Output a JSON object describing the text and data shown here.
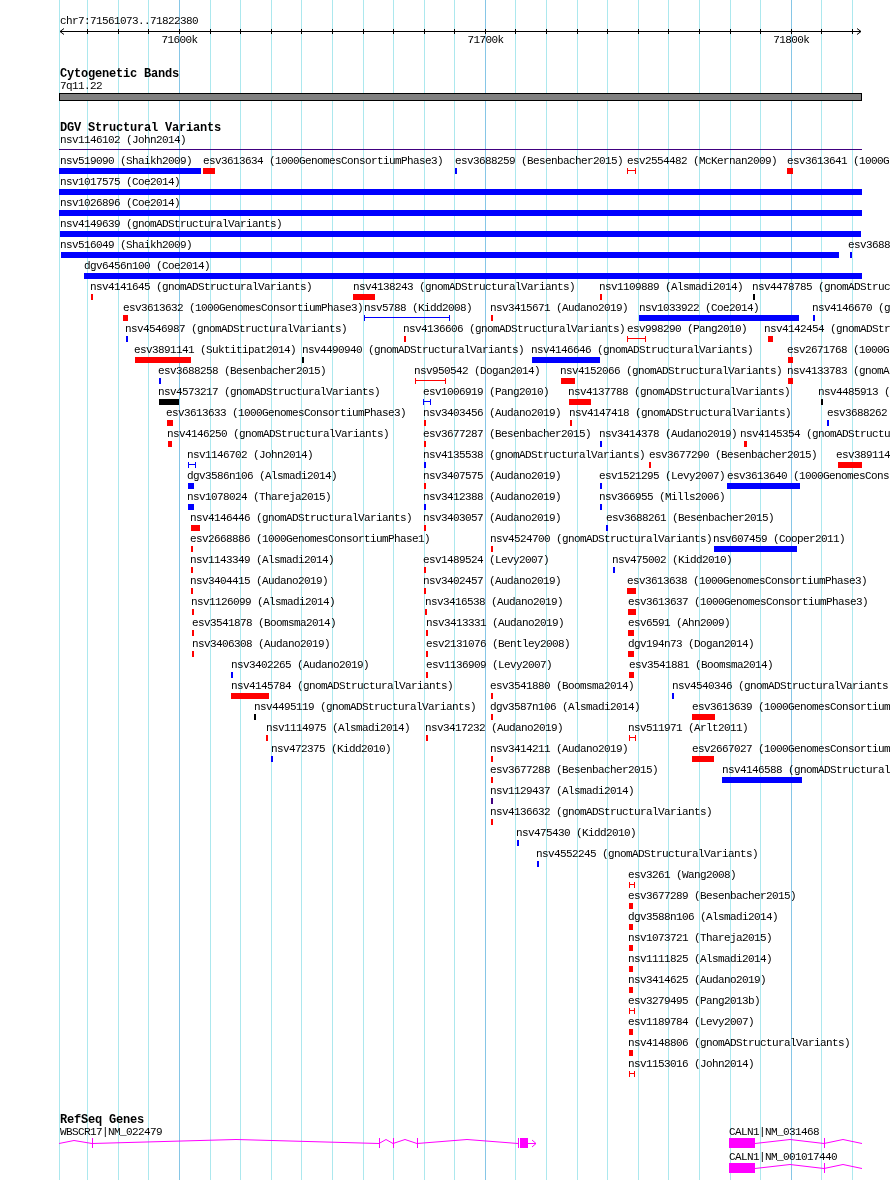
{
  "ruler": {
    "region": "chr7:71561073..71822380",
    "ticks": [
      "71600k",
      "71700k",
      "71800k"
    ]
  },
  "cytogenetic_bands": {
    "title": "Cytogenetic Bands",
    "band": "7q11.22"
  },
  "dgv_structural_variants": {
    "title": "DGV Structural Variants",
    "rows": [
      {
        "features": [
          {
            "label": "nsv1146102 (John2014)",
            "kind": "line",
            "color": "#400080"
          }
        ]
      },
      {
        "features": [
          {
            "label": "nsv519090 (Shaikh2009)",
            "kind": "block",
            "color": "#0000ff"
          },
          {
            "label": "esv3613634 (1000GenomesConsortiumPhase3)",
            "kind": "block",
            "color": "#ff0000"
          },
          {
            "label": "esv3688259 (Besenbacher2015)",
            "kind": "block",
            "color": "#0000ff"
          },
          {
            "label": "esv2554482 (McKernan2009)",
            "kind": "span",
            "color": "#ff0000"
          },
          {
            "label": "esv3613641 (1000G",
            "kind": "block",
            "color": "#ff0000"
          }
        ]
      },
      {
        "features": [
          {
            "label": "nsv1017575 (Coe2014)",
            "kind": "block",
            "color": "#0000ff"
          }
        ]
      },
      {
        "features": [
          {
            "label": "nsv1026896 (Coe2014)",
            "kind": "block",
            "color": "#0000ff"
          }
        ]
      },
      {
        "features": [
          {
            "label": "nsv4149639 (gnomADStructuralVariants)",
            "kind": "block",
            "color": "#0000ff"
          }
        ]
      },
      {
        "features": [
          {
            "label": "nsv516049 (Shaikh2009)",
            "kind": "block",
            "color": "#0000ff"
          },
          {
            "label": "esv3688",
            "kind": "block",
            "color": "#0000ff"
          }
        ]
      },
      {
        "features": [
          {
            "label": "dgv6456n100 (Coe2014)",
            "kind": "block",
            "color": "#0000ff"
          }
        ]
      },
      {
        "features": [
          {
            "label": "nsv4141645 (gnomADStructuralVariants)",
            "kind": "block",
            "color": "#ff0000"
          },
          {
            "label": "nsv4138243 (gnomADStructuralVariants)",
            "kind": "block",
            "color": "#ff0000"
          },
          {
            "label": "nsv1109889 (Alsmadi2014)",
            "kind": "block",
            "color": "#ff0000"
          },
          {
            "label": "nsv4478785 (gnomADStruc",
            "kind": "block",
            "color": "#000000"
          }
        ]
      },
      {
        "features": [
          {
            "label": "esv3613632 (1000GenomesConsortiumPhase3)",
            "kind": "block",
            "color": "#ff0000"
          },
          {
            "label": "nsv5788 (Kidd2008)",
            "kind": "span",
            "color": "#0000ff"
          },
          {
            "label": "nsv3415671 (Audano2019)",
            "kind": "block",
            "color": "#ff0000"
          },
          {
            "label": "nsv1033922 (Coe2014)",
            "kind": "block",
            "color": "#0000ff"
          },
          {
            "label": "nsv4146670 (g",
            "kind": "block",
            "color": "#0000ff"
          }
        ]
      },
      {
        "features": [
          {
            "label": "nsv4546987 (gnomADStructuralVariants)",
            "kind": "block",
            "color": "#0000ff"
          },
          {
            "label": "nsv4136606 (gnomADStructuralVariants)",
            "kind": "block",
            "color": "#ff0000"
          },
          {
            "label": "esv998290 (Pang2010)",
            "kind": "span",
            "color": "#ff0000"
          },
          {
            "label": "nsv4142454 (gnomADStr",
            "kind": "block",
            "color": "#ff0000"
          }
        ]
      },
      {
        "features": [
          {
            "label": "esv3891141 (Suktitipat2014)",
            "kind": "block",
            "color": "#ff0000"
          },
          {
            "label": "nsv4490940 (gnomADStructuralVariants)",
            "kind": "block",
            "color": "#000000"
          },
          {
            "label": "nsv4146646 (gnomADStructuralVariants)",
            "kind": "block",
            "color": "#0000ff"
          },
          {
            "label": "esv2671768 (1000G",
            "kind": "block",
            "color": "#ff0000"
          }
        ]
      },
      {
        "features": [
          {
            "label": "esv3688258 (Besenbacher2015)",
            "kind": "block",
            "color": "#0000ff"
          },
          {
            "label": "nsv950542 (Dogan2014)",
            "kind": "span",
            "color": "#ff0000"
          },
          {
            "label": "nsv4152066 (gnomADStructuralVariants)",
            "kind": "block",
            "color": "#ff0000"
          },
          {
            "label": "nsv4133783 (gnomA",
            "kind": "block",
            "color": "#ff0000"
          }
        ]
      },
      {
        "features": [
          {
            "label": "nsv4573217 (gnomADStructuralVariants)",
            "kind": "block",
            "color": "#000000"
          },
          {
            "label": "esv1006919 (Pang2010)",
            "kind": "span",
            "color": "#0000ff"
          },
          {
            "label": "nsv4137788 (gnomADStructuralVariants)",
            "kind": "block",
            "color": "#ff0000"
          },
          {
            "label": "nsv4485913 (",
            "kind": "block",
            "color": "#000000"
          }
        ]
      },
      {
        "features": [
          {
            "label": "esv3613633 (1000GenomesConsortiumPhase3)",
            "kind": "block",
            "color": "#ff0000"
          },
          {
            "label": "nsv3403456 (Audano2019)",
            "kind": "block",
            "color": "#ff0000"
          },
          {
            "label": "nsv4147418 (gnomADStructuralVariants)",
            "kind": "block",
            "color": "#ff0000"
          },
          {
            "label": "esv3688262",
            "kind": "block",
            "color": "#0000ff"
          }
        ]
      },
      {
        "features": [
          {
            "label": "nsv4146250 (gnomADStructuralVariants)",
            "kind": "block",
            "color": "#ff0000"
          },
          {
            "label": "esv3677287 (Besenbacher2015)",
            "kind": "block",
            "color": "#ff0000"
          },
          {
            "label": "nsv3414378 (Audano2019)",
            "kind": "block",
            "color": "#0000ff"
          },
          {
            "label": "nsv4145354 (gnomADStructu",
            "kind": "block",
            "color": "#ff0000"
          }
        ]
      },
      {
        "features": [
          {
            "label": "nsv1146702 (John2014)",
            "kind": "span",
            "color": "#0000ff"
          },
          {
            "label": "nsv4135538 (gnomADStructuralVariants)",
            "kind": "block",
            "color": "#0000ff"
          },
          {
            "label": "esv3677290 (Besenbacher2015)",
            "kind": "block",
            "color": "#ff0000"
          },
          {
            "label": "esv389114",
            "kind": "block",
            "color": "#ff0000"
          }
        ]
      },
      {
        "features": [
          {
            "label": "dgv3586n106 (Alsmadi2014)",
            "kind": "block",
            "color": "#0000ff"
          },
          {
            "label": "nsv3407575 (Audano2019)",
            "kind": "block",
            "color": "#ff0000"
          },
          {
            "label": "esv1521295 (Levy2007)",
            "kind": "block",
            "color": "#0000ff"
          },
          {
            "label": "esv3613640 (1000GenomesCons",
            "kind": "block",
            "color": "#0000ff"
          }
        ]
      },
      {
        "features": [
          {
            "label": "nsv1078024 (Thareja2015)",
            "kind": "block",
            "color": "#0000ff"
          },
          {
            "label": "nsv3412388 (Audano2019)",
            "kind": "block",
            "color": "#0000ff"
          },
          {
            "label": "nsv366955 (Mills2006)",
            "kind": "block",
            "color": "#0000ff"
          }
        ]
      },
      {
        "features": [
          {
            "label": "nsv4146446 (gnomADStructuralVariants)",
            "kind": "block",
            "color": "#ff0000"
          },
          {
            "label": "nsv3403057 (Audano2019)",
            "kind": "block",
            "color": "#ff0000"
          },
          {
            "label": "esv3688261 (Besenbacher2015)",
            "kind": "block",
            "color": "#0000ff"
          }
        ]
      },
      {
        "features": [
          {
            "label": "esv2668886 (1000GenomesConsortiumPhase1)",
            "kind": "block",
            "color": "#ff0000"
          },
          {
            "label": "nsv4524700 (gnomADStructuralVariants)",
            "kind": "block",
            "color": "#ff0000"
          },
          {
            "label": "nsv607459 (Cooper2011)",
            "kind": "block",
            "color": "#0000ff"
          }
        ]
      },
      {
        "features": [
          {
            "label": "nsv1143349 (Alsmadi2014)",
            "kind": "block",
            "color": "#ff0000"
          },
          {
            "label": "esv1489524 (Levy2007)",
            "kind": "block",
            "color": "#ff0000"
          },
          {
            "label": "nsv475002 (Kidd2010)",
            "kind": "block",
            "color": "#0000ff"
          }
        ]
      },
      {
        "features": [
          {
            "label": "nsv3404415 (Audano2019)",
            "kind": "block",
            "color": "#ff0000"
          },
          {
            "label": "nsv3402457 (Audano2019)",
            "kind": "block",
            "color": "#ff0000"
          },
          {
            "label": "esv3613638 (1000GenomesConsortiumPhase3)",
            "kind": "block",
            "color": "#ff0000"
          }
        ]
      },
      {
        "features": [
          {
            "label": "nsv1126099 (Alsmadi2014)",
            "kind": "block",
            "color": "#ff0000"
          },
          {
            "label": "nsv3416538 (Audano2019)",
            "kind": "block",
            "color": "#ff0000"
          },
          {
            "label": "esv3613637 (1000GenomesConsortiumPhase3)",
            "kind": "block",
            "color": "#ff0000"
          }
        ]
      },
      {
        "features": [
          {
            "label": "esv3541878 (Boomsma2014)",
            "kind": "block",
            "color": "#ff0000"
          },
          {
            "label": "nsv3413331 (Audano2019)",
            "kind": "block",
            "color": "#ff0000"
          },
          {
            "label": "esv6591 (Ahn2009)",
            "kind": "block",
            "color": "#ff0000"
          }
        ]
      },
      {
        "features": [
          {
            "label": "nsv3406308 (Audano2019)",
            "kind": "block",
            "color": "#ff0000"
          },
          {
            "label": "esv2131076 (Bentley2008)",
            "kind": "block",
            "color": "#ff0000"
          },
          {
            "label": "dgv194n73 (Dogan2014)",
            "kind": "block",
            "color": "#ff0000"
          }
        ]
      },
      {
        "features": [
          {
            "label": "nsv3402265 (Audano2019)",
            "kind": "block",
            "color": "#0000ff"
          },
          {
            "label": "esv1136909 (Levy2007)",
            "kind": "block",
            "color": "#ff0000"
          },
          {
            "label": "esv3541881 (Boomsma2014)",
            "kind": "block",
            "color": "#ff0000"
          }
        ]
      },
      {
        "features": [
          {
            "label": "nsv4145784 (gnomADStructuralVariants)",
            "kind": "block",
            "color": "#ff0000"
          },
          {
            "label": "esv3541880 (Boomsma2014)",
            "kind": "block",
            "color": "#ff0000"
          },
          {
            "label": "nsv4540346 (gnomADStructuralVariants",
            "kind": "block",
            "color": "#0000ff"
          }
        ]
      },
      {
        "features": [
          {
            "label": "nsv4495119 (gnomADStructuralVariants)",
            "kind": "block",
            "color": "#000000"
          },
          {
            "label": "dgv3587n106 (Alsmadi2014)",
            "kind": "block",
            "color": "#ff0000"
          },
          {
            "label": "esv3613639 (1000GenomesConsortium",
            "kind": "block",
            "color": "#ff0000"
          }
        ]
      },
      {
        "features": [
          {
            "label": "nsv1114975 (Alsmadi2014)",
            "kind": "block",
            "color": "#ff0000"
          },
          {
            "label": "nsv3417232 (Audano2019)",
            "kind": "block",
            "color": "#ff0000"
          },
          {
            "label": "nsv511971 (Arlt2011)",
            "kind": "span",
            "color": "#ff0000"
          }
        ]
      },
      {
        "features": [
          {
            "label": "nsv472375 (Kidd2010)",
            "kind": "block",
            "color": "#0000ff"
          },
          {
            "label": "nsv3414211 (Audano2019)",
            "kind": "block",
            "color": "#ff0000"
          },
          {
            "label": "esv2667027 (1000GenomesConsortium",
            "kind": "block",
            "color": "#ff0000"
          }
        ]
      },
      {
        "features": [
          {
            "label": "esv3677288 (Besenbacher2015)",
            "kind": "block",
            "color": "#ff0000"
          },
          {
            "label": "nsv4146588 (gnomADStructural",
            "kind": "block",
            "color": "#0000ff"
          }
        ]
      },
      {
        "features": [
          {
            "label": "nsv1129437 (Alsmadi2014)",
            "kind": "block",
            "color": "#400080"
          }
        ]
      },
      {
        "features": [
          {
            "label": "nsv4136632 (gnomADStructuralVariants)",
            "kind": "block",
            "color": "#ff0000"
          }
        ]
      },
      {
        "features": [
          {
            "label": "nsv475430 (Kidd2010)",
            "kind": "block",
            "color": "#0000ff"
          }
        ]
      },
      {
        "features": [
          {
            "label": "nsv4552245 (gnomADStructuralVariants)",
            "kind": "block",
            "color": "#0000ff"
          }
        ]
      },
      {
        "features": [
          {
            "label": "esv3261 (Wang2008)",
            "kind": "span",
            "color": "#ff0000"
          }
        ]
      },
      {
        "features": [
          {
            "label": "esv3677289 (Besenbacher2015)",
            "kind": "block",
            "color": "#ff0000"
          }
        ]
      },
      {
        "features": [
          {
            "label": "dgv3588n106 (Alsmadi2014)",
            "kind": "block",
            "color": "#ff0000"
          }
        ]
      },
      {
        "features": [
          {
            "label": "nsv1073721 (Thareja2015)",
            "kind": "block",
            "color": "#ff0000"
          }
        ]
      },
      {
        "features": [
          {
            "label": "nsv1111825 (Alsmadi2014)",
            "kind": "block",
            "color": "#ff0000"
          }
        ]
      },
      {
        "features": [
          {
            "label": "nsv3414625 (Audano2019)",
            "kind": "block",
            "color": "#ff0000"
          }
        ]
      },
      {
        "features": [
          {
            "label": "esv3279495 (Pang2013b)",
            "kind": "span",
            "color": "#ff0000"
          }
        ]
      },
      {
        "features": [
          {
            "label": "esv1189784 (Levy2007)",
            "kind": "block",
            "color": "#ff0000"
          }
        ]
      },
      {
        "features": [
          {
            "label": "nsv4148806 (gnomADStructuralVariants)",
            "kind": "block",
            "color": "#ff0000"
          }
        ]
      },
      {
        "features": [
          {
            "label": "nsv1153016 (John2014)",
            "kind": "span",
            "color": "#ff0000"
          }
        ]
      }
    ]
  },
  "refseq_genes": {
    "title": "RefSeq Genes",
    "rows": [
      {
        "genes": [
          {
            "label": "WBSCR17|NM_022479"
          },
          {
            "label": "CALN1|NM_031468"
          }
        ]
      },
      {
        "genes": [
          {
            "label": "CALN1|NM_001017440"
          }
        ]
      }
    ]
  }
}
